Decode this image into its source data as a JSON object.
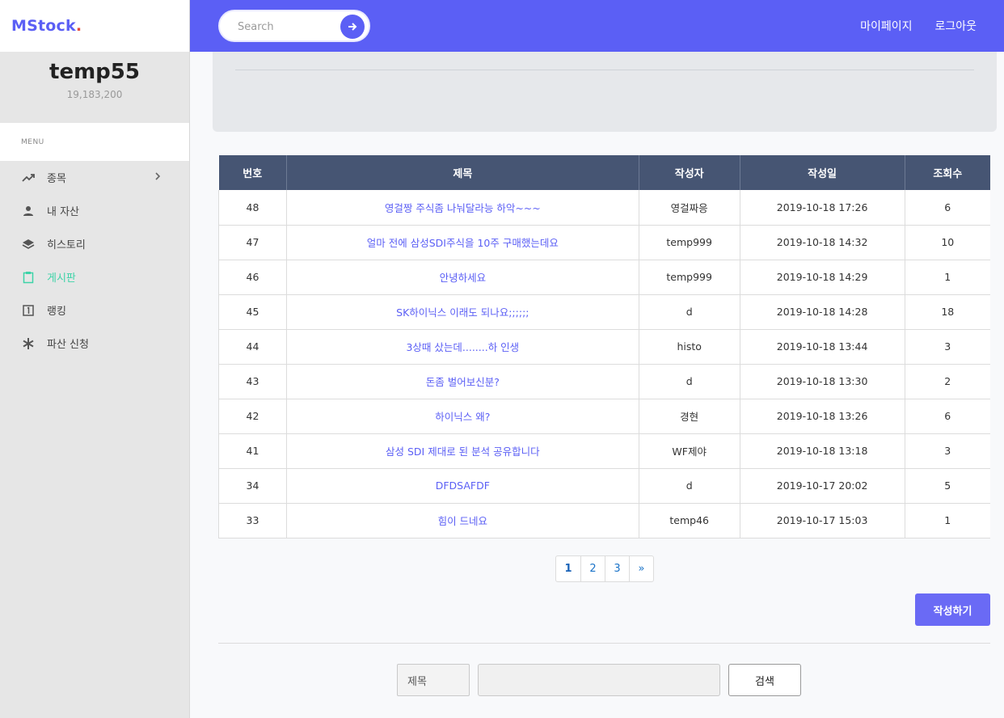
{
  "brand": {
    "name": "MStock",
    "dot": ".",
    "dot_color": "#e74c3c",
    "accent": "#5b5ff5"
  },
  "user": {
    "name": "temp55",
    "balance": "19,183,200"
  },
  "sidebar": {
    "menu_heading": "MENU",
    "items": [
      {
        "label": "종목",
        "icon": "trending-up-icon",
        "has_chevron": true
      },
      {
        "label": "내 자산",
        "icon": "person-icon"
      },
      {
        "label": "히스토리",
        "icon": "layers-icon"
      },
      {
        "label": "게시판",
        "icon": "clipboard-icon",
        "active": true
      },
      {
        "label": "랭킹",
        "icon": "number-one-box-icon"
      },
      {
        "label": "파산 신청",
        "icon": "asterisk-icon"
      }
    ]
  },
  "topbar": {
    "search_placeholder": "Search",
    "links": [
      "마이페이지",
      "로그아웃"
    ]
  },
  "board": {
    "columns": [
      "번호",
      "제목",
      "작성자",
      "작성일",
      "조회수"
    ],
    "rows": [
      {
        "no": "48",
        "title": "영걸짱 주식좀 나눠달라능 하악~~~",
        "author": "영걸짜응",
        "date": "2019-10-18 17:26",
        "views": "6"
      },
      {
        "no": "47",
        "title": "얼마 전에 삼성SDI주식을 10주 구매했는데요",
        "author": "temp999",
        "date": "2019-10-18 14:32",
        "views": "10"
      },
      {
        "no": "46",
        "title": "안녕하세요",
        "author": "temp999",
        "date": "2019-10-18 14:29",
        "views": "1"
      },
      {
        "no": "45",
        "title": "SK하이닉스 이래도 되나요;;;;;;",
        "author": "d",
        "date": "2019-10-18 14:28",
        "views": "18"
      },
      {
        "no": "44",
        "title": "3상때 샀는데........하 인생",
        "author": "histo",
        "date": "2019-10-18 13:44",
        "views": "3"
      },
      {
        "no": "43",
        "title": "돈좀 벌어보신분?",
        "author": "d",
        "date": "2019-10-18 13:30",
        "views": "2"
      },
      {
        "no": "42",
        "title": "하이닉스 왜?",
        "author": "경현",
        "date": "2019-10-18 13:26",
        "views": "6"
      },
      {
        "no": "41",
        "title": "삼성 SDI 제대로 된 분석 공유합니다",
        "author": "WF제야",
        "date": "2019-10-18 13:18",
        "views": "3"
      },
      {
        "no": "34",
        "title": "DFDSAFDF",
        "author": "d",
        "date": "2019-10-17 20:02",
        "views": "5"
      },
      {
        "no": "33",
        "title": "힘이 드네요",
        "author": "temp46",
        "date": "2019-10-17 15:03",
        "views": "1"
      }
    ]
  },
  "pagination": {
    "pages": [
      "1",
      "2",
      "3"
    ],
    "next": "»",
    "current": "1"
  },
  "actions": {
    "write_label": "작성하기"
  },
  "search_form": {
    "field_selected": "제목",
    "keyword_value": "",
    "submit_label": "검색"
  }
}
